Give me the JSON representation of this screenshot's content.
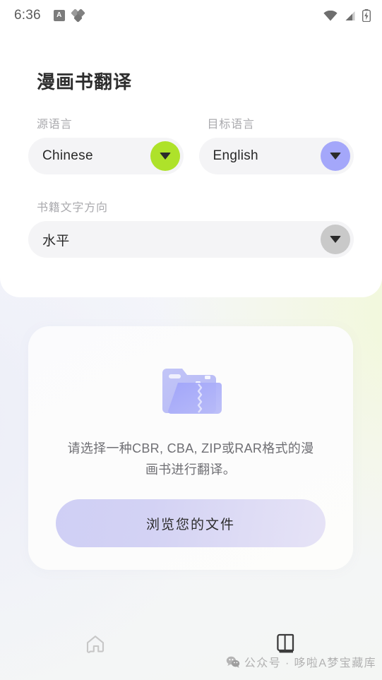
{
  "status_bar": {
    "time": "6:36",
    "left_icons": [
      {
        "name": "app-badge-icon",
        "glyph": "A"
      },
      {
        "name": "app-cluster-icon"
      }
    ],
    "right_icons": [
      "wifi-icon",
      "cellular-signal-icon",
      "battery-charging-icon"
    ]
  },
  "header": {
    "title": "漫画书翻译"
  },
  "form": {
    "source_language": {
      "label": "源语言",
      "value": "Chinese",
      "caret_color": "#aee22a"
    },
    "target_language": {
      "label": "目标语言",
      "value": "English",
      "caret_color": "#a4a7fa"
    },
    "text_direction": {
      "label": "书籍文字方向",
      "value": "水平",
      "caret_color": "#c9c9c9"
    }
  },
  "drop_zone": {
    "icon": "zip-folder-icon",
    "description": "请选择一种CBR, CBA, ZIP或RAR格式的漫画书进行翻译。",
    "button_label": "浏览您的文件",
    "button_color": "#d5d3f4"
  },
  "bottom_nav": {
    "items": [
      {
        "name": "home",
        "icon": "home-icon",
        "active": false,
        "color": "#c7c7c7"
      },
      {
        "name": "library",
        "icon": "book-icon",
        "active": true,
        "color": "#3c3c3c"
      }
    ]
  },
  "watermark": {
    "icon": "wechat-icon",
    "text": "公众号 · 哆啦A梦宝藏库"
  }
}
